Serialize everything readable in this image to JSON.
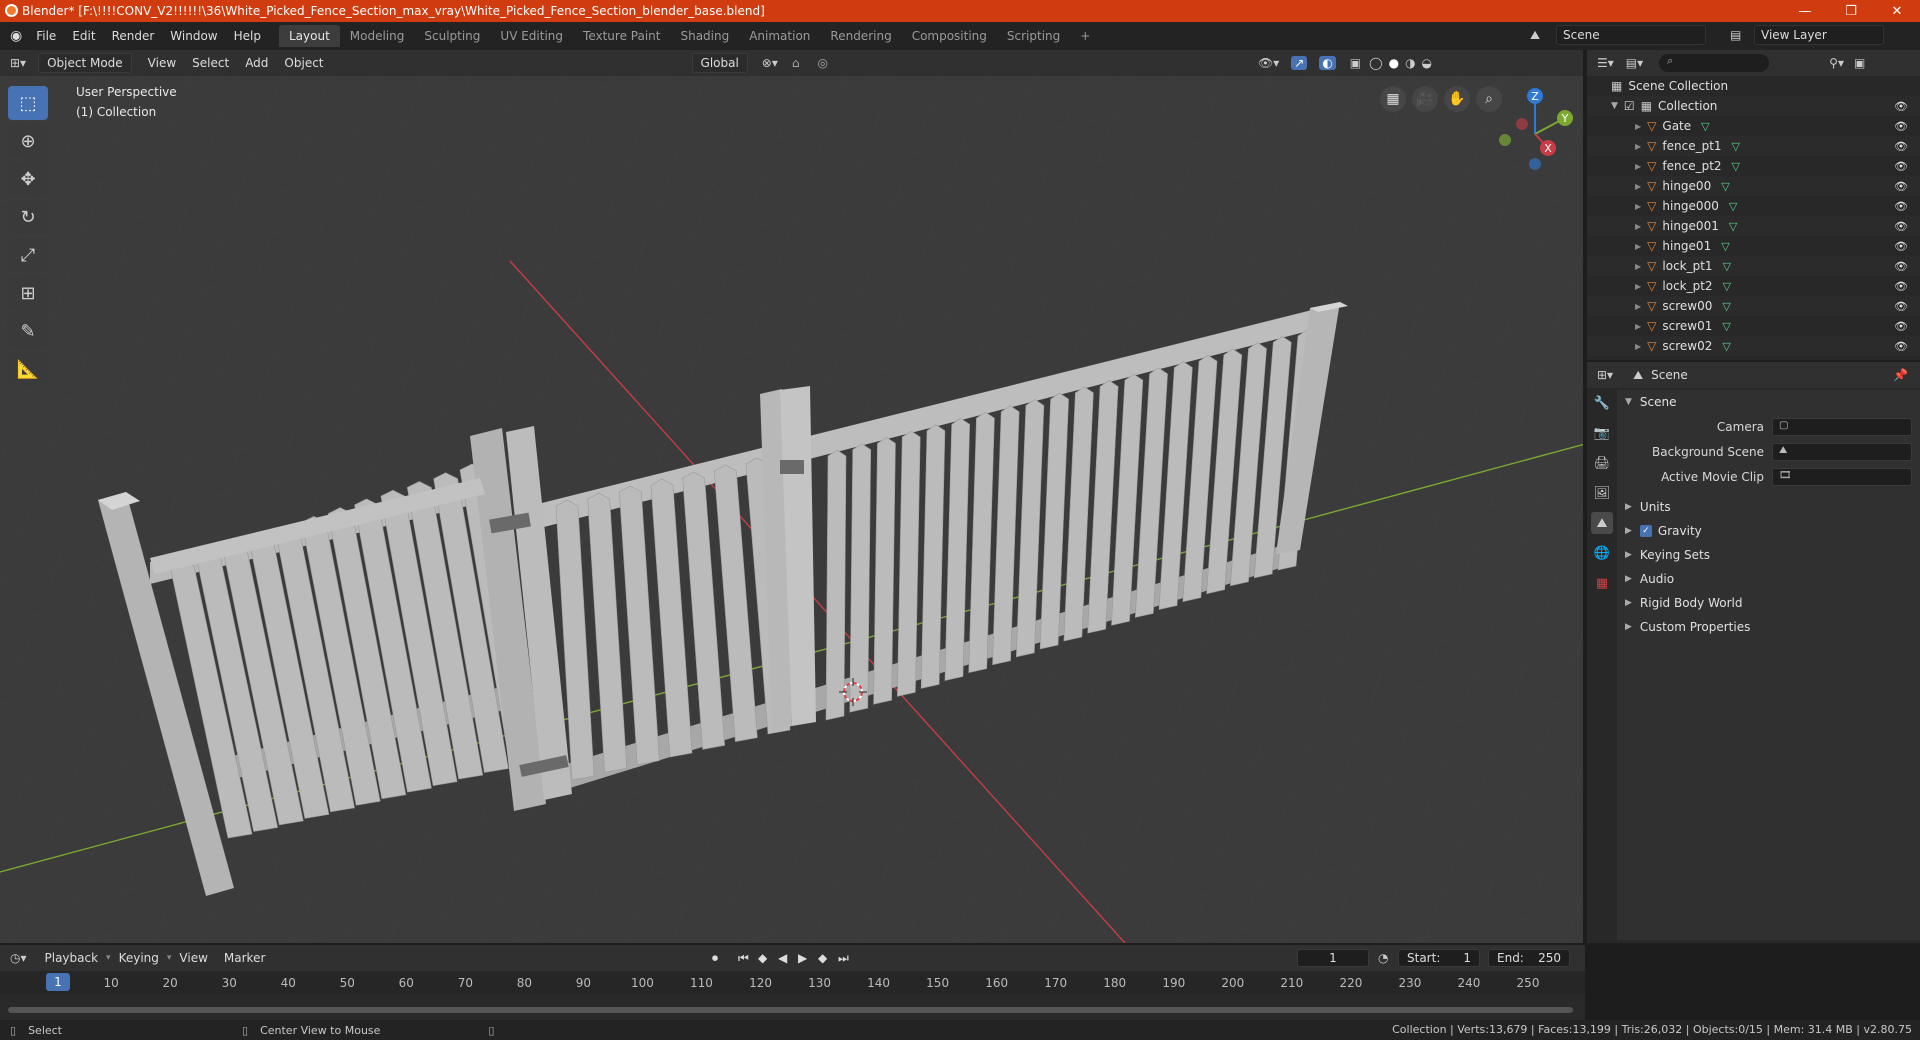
{
  "window": {
    "title": "Blender* [F:\\!!!!CONV_V2!!!!!!\\36\\White_Picked_Fence_Section_max_vray\\White_Picked_Fence_Section_blender_base.blend]",
    "minimize": "—",
    "restore": "❐",
    "close": "✕"
  },
  "menu": [
    "File",
    "Edit",
    "Render",
    "Window",
    "Help"
  ],
  "workspaces": [
    "Layout",
    "Modeling",
    "Sculpting",
    "UV Editing",
    "Texture Paint",
    "Shading",
    "Animation",
    "Rendering",
    "Compositing",
    "Scripting"
  ],
  "workspace_add": "+",
  "scene_field": "Scene",
  "view_layer_field": "View Layer",
  "viewport": {
    "mode": "Object Mode",
    "menus": [
      "View",
      "Select",
      "Add",
      "Object"
    ],
    "transform": "Global",
    "info_line1": "User Perspective",
    "info_line2": "(1) Collection",
    "gizmo": {
      "z": "Z",
      "y": "Y",
      "x": "X"
    }
  },
  "outliner": {
    "root": "Scene Collection",
    "collection": "Collection",
    "objects": [
      "Gate",
      "fence_pt1",
      "fence_pt2",
      "hinge00",
      "hinge000",
      "hinge001",
      "hinge01",
      "lock_pt1",
      "lock_pt2",
      "screw00",
      "screw01",
      "screw02"
    ]
  },
  "properties": {
    "header": "Scene",
    "section": "Scene",
    "rows": [
      {
        "label": "Camera"
      },
      {
        "label": "Background Scene"
      },
      {
        "label": "Active Movie Clip"
      }
    ],
    "subsections": [
      "Units",
      "Gravity",
      "Keying Sets",
      "Audio",
      "Rigid Body World",
      "Custom Properties"
    ],
    "gravity_checked": true
  },
  "timeline": {
    "menus": [
      "Playback",
      "Keying",
      "View",
      "Marker"
    ],
    "current_frame": "1",
    "start_label": "Start:",
    "start": "1",
    "end_label": "End:",
    "end": "250",
    "ticks": [
      "1",
      "10",
      "20",
      "30",
      "40",
      "50",
      "60",
      "70",
      "80",
      "90",
      "100",
      "110",
      "120",
      "130",
      "140",
      "150",
      "160",
      "170",
      "180",
      "190",
      "200",
      "210",
      "220",
      "230",
      "240",
      "250"
    ]
  },
  "status": {
    "left": "Select",
    "middle": "Center View to Mouse",
    "right": "Collection | Verts:13,679 | Faces:13,199 | Tris:26,032 | Objects:0/15 | Mem: 31.4 MB | v2.80.75"
  },
  "colors": {
    "accent": "#4772b3",
    "titlebar": "#d03c10",
    "xaxis": "#c83c46",
    "yaxis": "#7ca832"
  }
}
